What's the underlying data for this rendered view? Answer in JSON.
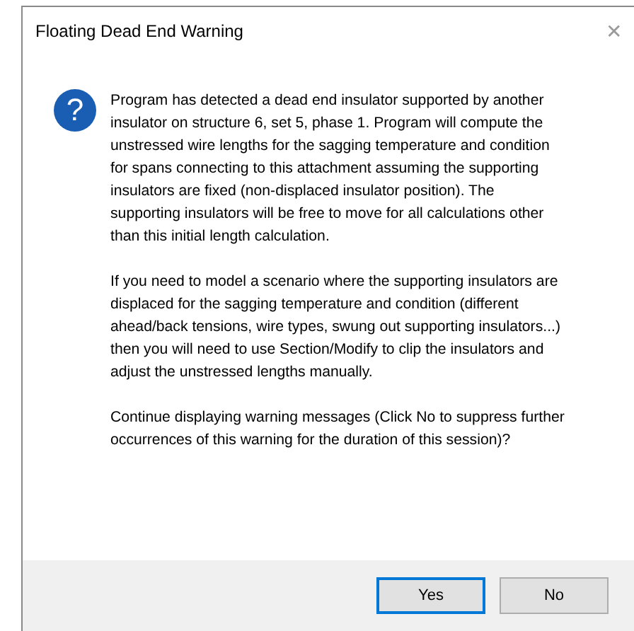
{
  "window": {
    "title": "Floating Dead End Warning",
    "close_glyph": "✕"
  },
  "icon_glyph": "?",
  "paragraphs": [
    "Program has detected a dead end insulator supported by another insulator on structure 6, set 5, phase 1.  Program will compute the unstressed wire lengths for the sagging temperature and condition for spans connecting to this attachment assuming the supporting insulators are fixed (non-displaced insulator position).  The supporting insulators will be free to move for all calculations other than this initial length calculation.",
    "If you need to model a scenario where the supporting insulators are displaced for the sagging temperature and condition (different ahead/back tensions, wire types, swung out supporting insulators...) then you will need to use Section/Modify to clip the insulators and adjust the unstressed lengths manually.",
    "Continue displaying warning messages (Click No to suppress further occurrences of this warning for the duration of this session)?"
  ],
  "buttons": [
    {
      "label": "Yes",
      "default": true
    },
    {
      "label": "No",
      "default": false
    }
  ]
}
